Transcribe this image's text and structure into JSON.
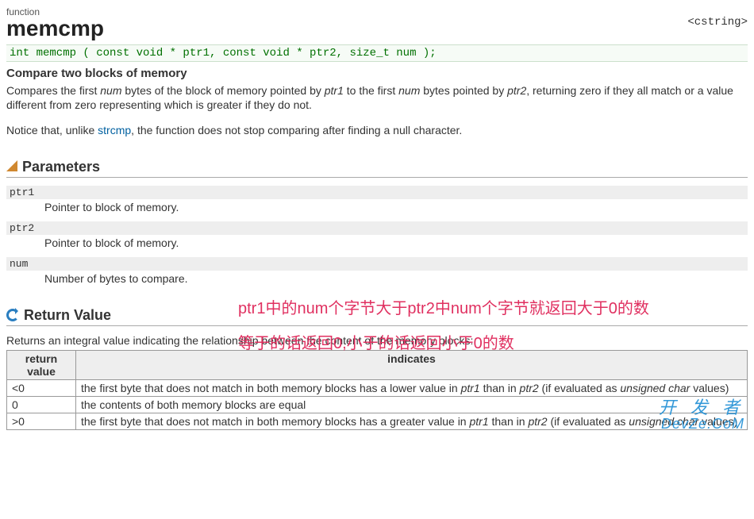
{
  "header": {
    "type": "function",
    "name": "memcmp",
    "include": "<cstring>",
    "signature": "int memcmp ( const void * ptr1, const void * ptr2, size_t num );"
  },
  "summary": {
    "heading": "Compare two blocks of memory",
    "p1a": "Compares the first ",
    "p1b": " bytes of the block of memory pointed by ",
    "p1c": " to the first ",
    "p1d": " bytes pointed by ",
    "p1e": ", returning zero if they all match or a value different from zero representing which is greater if they do not.",
    "num": "num",
    "ptr1": "ptr1",
    "ptr2": "ptr2",
    "p2a": "Notice that, unlike ",
    "p2link": "strcmp",
    "p2b": ", the function does not stop comparing after finding a null character."
  },
  "parameters": {
    "title": "Parameters",
    "items": [
      {
        "name": "ptr1",
        "desc": "Pointer to block of memory."
      },
      {
        "name": "ptr2",
        "desc": "Pointer to block of memory."
      },
      {
        "name": "num",
        "desc": "Number of bytes to compare."
      }
    ]
  },
  "annotations": {
    "a1": "ptr1中的num个字节大于ptr2中num个字节就返回大于0的数",
    "a2": "等于的话返回0,小于的话返回小于0的数"
  },
  "return_value": {
    "title": "Return Value",
    "desc": "Returns an integral value indicating the relationship between the content of the memory blocks:",
    "headers": {
      "rv": "return value",
      "ind": "indicates"
    },
    "rows": [
      {
        "rv": "<0",
        "a": "the first byte that does not match in both memory blocks has a lower value in ",
        "ptr1": "ptr1",
        "mid": " than in ",
        "ptr2": "ptr2",
        "b": " (if evaluated as ",
        "uc": "unsigned char",
        "c": " values)"
      },
      {
        "rv": "0",
        "a": "the contents of both memory blocks are equal",
        "plain": true
      },
      {
        "rv": ">0",
        "a": "the first byte that does not match in both memory blocks has a greater value in ",
        "ptr1": "ptr1",
        "mid": " than in ",
        "ptr2": "ptr2",
        "b": " (if evaluated as ",
        "uc": "unsigned char",
        "c": " values)"
      }
    ]
  },
  "watermark": {
    "l1": "开 发 者",
    "l2": "DevZe.CoM"
  }
}
